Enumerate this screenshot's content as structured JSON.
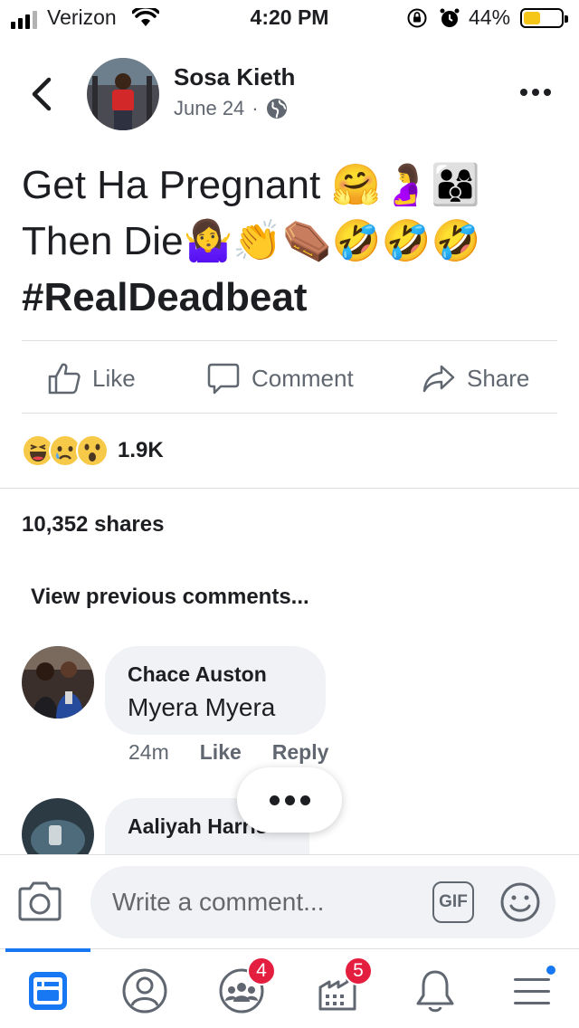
{
  "status_bar": {
    "carrier": "Verizon",
    "time": "4:20 PM",
    "battery_percent": "44%",
    "battery_level": 0.44,
    "icons": [
      "signal-icon",
      "wifi-icon",
      "orientation-lock-icon",
      "alarm-icon",
      "battery-icon"
    ]
  },
  "post": {
    "author": "Sosa Kieth",
    "date": "June 24",
    "separator": "·",
    "privacy_icon": "globe-icon",
    "text_lines": [
      "Get Ha Pregnant 🤗🤰👨‍👩‍👦",
      "Then Die🤷‍♀️👏⚰️🤣🤣🤣"
    ],
    "hashtag": "#RealDeadbeat"
  },
  "actions": {
    "like": "Like",
    "comment": "Comment",
    "share": "Share"
  },
  "reactions": {
    "types": [
      "haha-reaction",
      "sad-reaction",
      "wow-reaction"
    ],
    "count": "1.9K"
  },
  "shares": "10,352 shares",
  "view_previous": "View previous comments...",
  "comments": [
    {
      "author": "Chace Auston",
      "text": "Myera Myera",
      "time": "24m",
      "like": "Like",
      "reply": "Reply"
    },
    {
      "author": "Aaliyah Harris",
      "text": ""
    }
  ],
  "composer": {
    "placeholder": "Write a comment...",
    "gif_label": "GIF"
  },
  "tab_bar": {
    "tabs": [
      "news-feed-tab",
      "profile-tab",
      "groups-tab",
      "marketplace-tab",
      "notifications-tab",
      "menu-tab"
    ],
    "groups_badge": "4",
    "marketplace_badge": "5"
  },
  "colors": {
    "accent": "#1877f2",
    "badge": "#e41e3f",
    "secondary_text": "#606770",
    "bubble_bg": "#f0f2f5"
  }
}
